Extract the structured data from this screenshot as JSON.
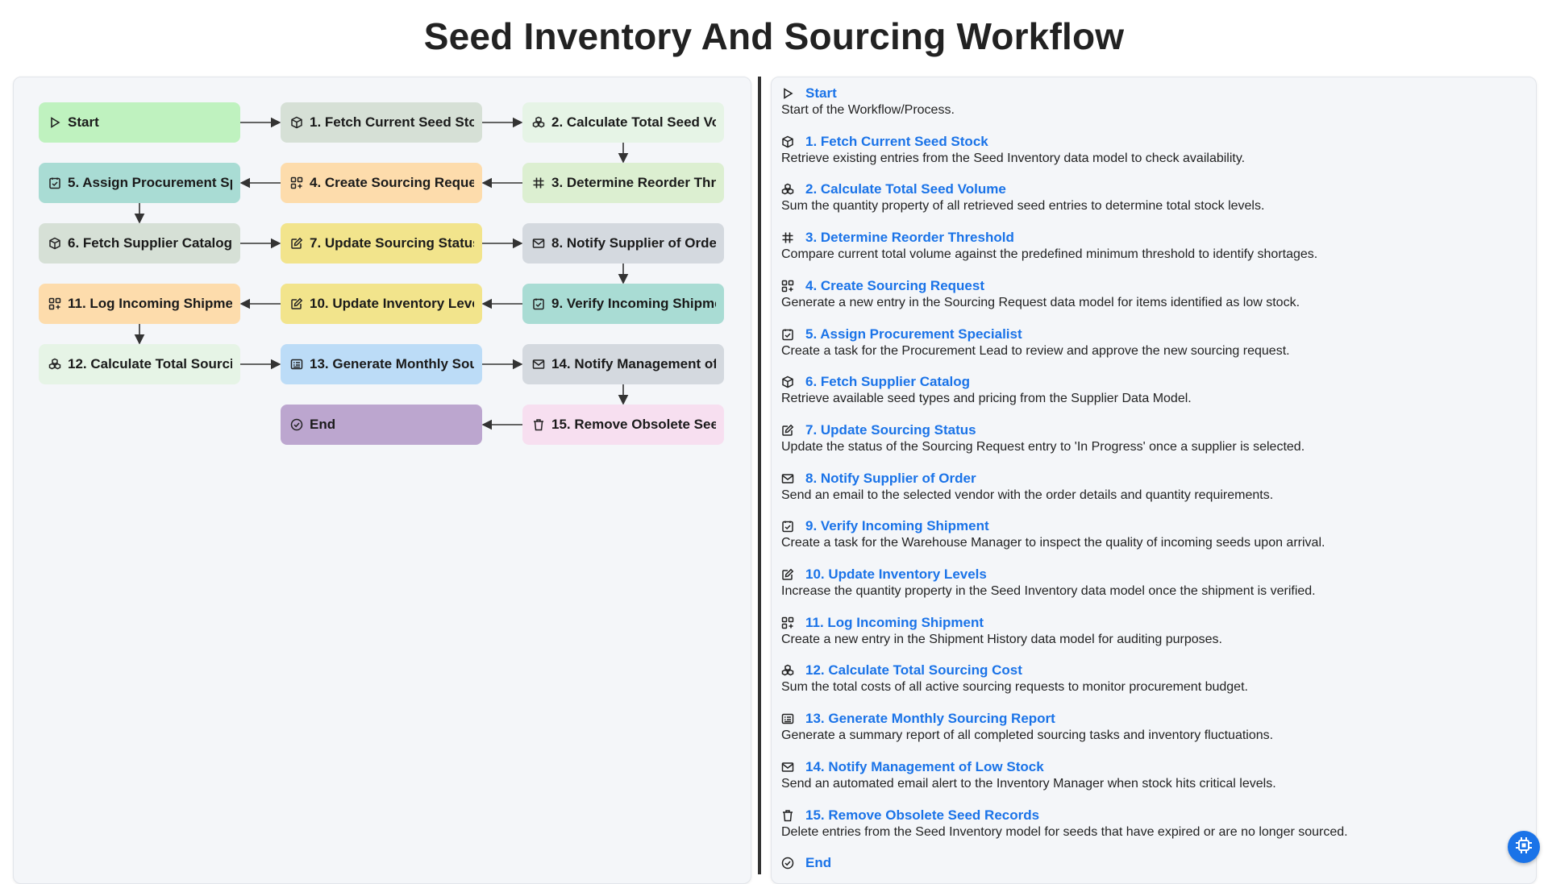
{
  "title": "Seed Inventory And Sourcing Workflow",
  "nodes": [
    {
      "id": "start",
      "label": "Start",
      "icon": "play-icon",
      "color": "#bff2bf"
    },
    {
      "id": "n1",
      "label": "1. Fetch Current Seed Stock",
      "icon": "box-icon",
      "color": "#d6e0d6"
    },
    {
      "id": "n2",
      "label": "2. Calculate Total Seed Volume",
      "icon": "calculate-icon",
      "color": "#e6f4e6"
    },
    {
      "id": "n3",
      "label": "3. Determine Reorder Threshold",
      "icon": "hash-icon",
      "color": "#dcefd1"
    },
    {
      "id": "n4",
      "label": "4. Create Sourcing Request",
      "icon": "grid-plus-icon",
      "color": "#fddcac"
    },
    {
      "id": "n5",
      "label": "5. Assign Procurement Specialist",
      "icon": "task-check-icon",
      "color": "#a9dcd4"
    },
    {
      "id": "n6",
      "label": "6. Fetch Supplier Catalog",
      "icon": "box-icon",
      "color": "#d6e0d6"
    },
    {
      "id": "n7",
      "label": "7. Update Sourcing Status",
      "icon": "edit-icon",
      "color": "#f2e48c"
    },
    {
      "id": "n8",
      "label": "8. Notify Supplier of Order",
      "icon": "mail-icon",
      "color": "#d4d9df"
    },
    {
      "id": "n9",
      "label": "9. Verify Incoming Shipment",
      "icon": "task-check-icon",
      "color": "#a9dcd4"
    },
    {
      "id": "n10",
      "label": "10. Update Inventory Levels",
      "icon": "edit-icon",
      "color": "#f2e48c"
    },
    {
      "id": "n11",
      "label": "11. Log Incoming Shipment",
      "icon": "grid-plus-icon",
      "color": "#fddcac"
    },
    {
      "id": "n12",
      "label": "12. Calculate Total Sourcing Cost",
      "icon": "calculate-icon",
      "color": "#e6f4e6"
    },
    {
      "id": "n13",
      "label": "13. Generate Monthly Sourcing Report",
      "icon": "report-icon",
      "color": "#bcdcf7"
    },
    {
      "id": "n14",
      "label": "14. Notify Management of Low Stock",
      "icon": "mail-icon",
      "color": "#d4d9df"
    },
    {
      "id": "n15",
      "label": "15. Remove Obsolete Seed Records",
      "icon": "trash-icon",
      "color": "#f7dff0"
    },
    {
      "id": "end",
      "label": "End",
      "icon": "check-circle-icon",
      "color": "#bca6cf"
    }
  ],
  "steps": [
    {
      "title": "Start",
      "desc": "Start of the Workflow/Process.",
      "icon": "play-icon"
    },
    {
      "title": "1. Fetch Current Seed Stock",
      "desc": "Retrieve existing entries from the Seed Inventory data model to check availability.",
      "icon": "box-icon"
    },
    {
      "title": "2. Calculate Total Seed Volume",
      "desc": "Sum the quantity property of all retrieved seed entries to determine total stock levels.",
      "icon": "calculate-icon"
    },
    {
      "title": "3. Determine Reorder Threshold",
      "desc": "Compare current total volume against the predefined minimum threshold to identify shortages.",
      "icon": "hash-icon"
    },
    {
      "title": "4. Create Sourcing Request",
      "desc": "Generate a new entry in the Sourcing Request data model for items identified as low stock.",
      "icon": "grid-plus-icon"
    },
    {
      "title": "5. Assign Procurement Specialist",
      "desc": "Create a task for the Procurement Lead to review and approve the new sourcing request.",
      "icon": "task-check-icon"
    },
    {
      "title": "6. Fetch Supplier Catalog",
      "desc": "Retrieve available seed types and pricing from the Supplier Data Model.",
      "icon": "box-icon"
    },
    {
      "title": "7. Update Sourcing Status",
      "desc": "Update the status of the Sourcing Request entry to 'In Progress' once a supplier is selected.",
      "icon": "edit-icon"
    },
    {
      "title": "8. Notify Supplier of Order",
      "desc": "Send an email to the selected vendor with the order details and quantity requirements.",
      "icon": "mail-icon"
    },
    {
      "title": "9. Verify Incoming Shipment",
      "desc": "Create a task for the Warehouse Manager to inspect the quality of incoming seeds upon arrival.",
      "icon": "task-check-icon"
    },
    {
      "title": "10. Update Inventory Levels",
      "desc": "Increase the quantity property in the Seed Inventory data model once the shipment is verified.",
      "icon": "edit-icon"
    },
    {
      "title": "11. Log Incoming Shipment",
      "desc": "Create a new entry in the Shipment History data model for auditing purposes.",
      "icon": "grid-plus-icon"
    },
    {
      "title": "12. Calculate Total Sourcing Cost",
      "desc": "Sum the total costs of all active sourcing requests to monitor procurement budget.",
      "icon": "calculate-icon"
    },
    {
      "title": "13. Generate Monthly Sourcing Report",
      "desc": "Generate a summary report of all completed sourcing tasks and inventory fluctuations.",
      "icon": "report-icon"
    },
    {
      "title": "14. Notify Management of Low Stock",
      "desc": "Send an automated email alert to the Inventory Manager when stock hits critical levels.",
      "icon": "mail-icon"
    },
    {
      "title": "15. Remove Obsolete Seed Records",
      "desc": "Delete entries from the Seed Inventory model for seeds that have expired or are no longer sourced.",
      "icon": "trash-icon"
    },
    {
      "title": "End",
      "desc": "",
      "icon": "check-circle-icon"
    }
  ],
  "fab": {
    "icon": "chip-icon",
    "color": "#1a73e8"
  }
}
